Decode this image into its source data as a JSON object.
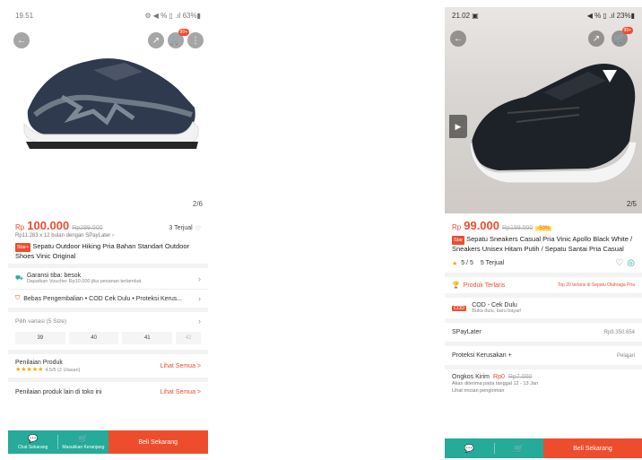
{
  "left": {
    "status": {
      "time": "19.51",
      "right": "⚙ ◀ % ▯ .ıl 63%▮"
    },
    "cart_badge": "99+",
    "img_counter": "2/6",
    "price": {
      "currency": "Rp",
      "amount": "100.000",
      "old": "Rp299.000",
      "sold": "3 Terjual"
    },
    "installment": "Rp11.283 x 12 bulan dengan SPayLater ›",
    "star_tag": "Star+",
    "title": "Sepatu Outdoor Hiking Pria Bahan Standart Outdoor Shoes Vinic Original",
    "garansi": {
      "label": "Garansi tiba: besok",
      "sub": "Dapatkan Voucher Rp10.000 jika pesanan terlambat."
    },
    "benefits": "Bebas Pengembalian • COD Cek Dulu • Proteksi Kerus...",
    "variants": {
      "label": "Pilih variasi (5 Size)",
      "sizes": [
        "39",
        "40",
        "41",
        "42"
      ]
    },
    "rating": {
      "label": "Penilaian Produk",
      "value": "4.5/5 (2 Ulasan)",
      "see_all": "Lihat Semua >"
    },
    "other": {
      "label": "Penilaian produk lain di toko ini",
      "see_all": "Lihat Semua >"
    },
    "bottom": {
      "chat": "Chat Sekarang",
      "cart": "Masukkan Keranjang",
      "buy": "Beli Sekarang"
    }
  },
  "right": {
    "status": {
      "time": "21.02 ▣",
      "right": "◀ % ▯ .ıl 23%▮"
    },
    "cart_badge": "99+",
    "img_counter": "2/5",
    "price": {
      "currency": "Rp",
      "amount": "99.000",
      "old": "Rp199.000",
      "disc": "-50%"
    },
    "star_tag": "Star",
    "title": "Sepatu Sneakers Casual Pria Vinic Apollo Black White / Sneakers Unisex Hitam Putih / Sepatu Santai Pria Casual",
    "rating_line": "5 / 5",
    "sold": "5 Terjual",
    "terlaris": {
      "label": "Produk Terlaris",
      "value": "Top 20 terlaris di Sepatu Olahraga Pria"
    },
    "cod": {
      "tag": "COD",
      "label": "COD - Cek Dulu",
      "sub": "Buka dulu, baru bayar!"
    },
    "spaylater": {
      "label": "SPayLater",
      "value": "Rp9.350.654"
    },
    "proteksi": {
      "label": "Proteksi Kerusakan +",
      "value": "Pelajari"
    },
    "ongkos": {
      "label": "Ongkos Kirim",
      "value": "Rp0",
      "old": "Rp7.000",
      "sub": "Akan diterima pada tanggal 12 - 13 Jan",
      "link": "Lihat rincian pengiriman"
    },
    "bottom": {
      "buy": "Beli Sekarang"
    }
  },
  "colors": {
    "accent": "#ee4d2d",
    "teal": "#26aa99"
  }
}
